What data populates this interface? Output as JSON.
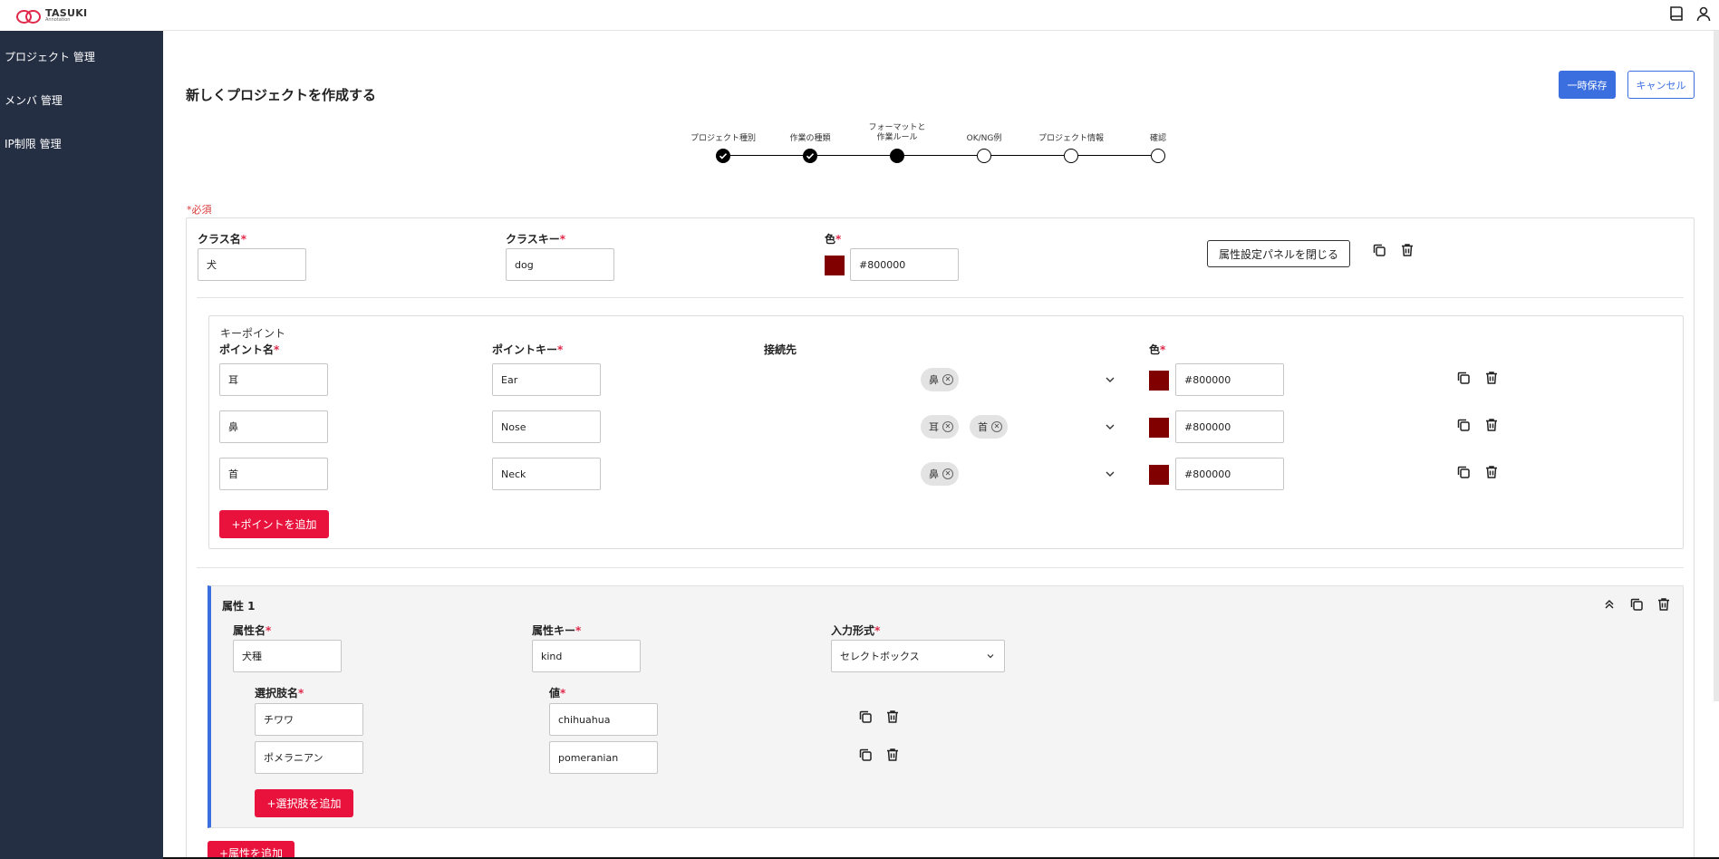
{
  "app": {
    "logo_line1": "TASUKI",
    "logo_line2": "Annotation"
  },
  "sidebar": {
    "items": [
      {
        "label": "プロジェクト 管理"
      },
      {
        "label": "メンバ 管理"
      },
      {
        "label": "IP制限 管理"
      }
    ]
  },
  "topbar": {
    "icons": [
      "book-icon",
      "user-icon"
    ]
  },
  "header": {
    "title": "新しくプロジェクトを作成する",
    "save_label": "一時保存",
    "cancel_label": "キャンセル"
  },
  "stepper": {
    "steps": [
      {
        "label": "プロジェクト種別",
        "state": "done"
      },
      {
        "label": "作業の種類",
        "state": "done"
      },
      {
        "label": "フォーマットと\n作業ルール",
        "state": "current"
      },
      {
        "label": "OK/NG例",
        "state": "pending"
      },
      {
        "label": "プロジェクト情報",
        "state": "pending"
      },
      {
        "label": "確認",
        "state": "pending"
      }
    ]
  },
  "form": {
    "required_note": "必須",
    "class": {
      "name_label": "クラス名",
      "name_value": "犬",
      "key_label": "クラスキー",
      "key_value": "dog",
      "color_label": "色",
      "color_value": "#800000",
      "close_panel_label": "属性設定パネルを閉じる"
    },
    "keypoints": {
      "caption": "キーポイント",
      "col_name": "ポイント名",
      "col_key": "ポイントキー",
      "col_connect": "接続先",
      "col_color": "色",
      "rows": [
        {
          "name": "耳",
          "key": "Ear",
          "connections": [
            "鼻"
          ],
          "color": "#800000"
        },
        {
          "name": "鼻",
          "key": "Nose",
          "connections": [
            "耳",
            "首"
          ],
          "color": "#800000"
        },
        {
          "name": "首",
          "key": "Neck",
          "connections": [
            "鼻"
          ],
          "color": "#800000"
        }
      ],
      "add_label": "+ポイントを追加"
    },
    "attribute": {
      "title": "属性 1",
      "name_label": "属性名",
      "name_value": "犬種",
      "key_label": "属性キー",
      "key_value": "kind",
      "input_type_label": "入力形式",
      "input_type_value": "セレクトボックス",
      "option_name_label": "選択肢名",
      "option_value_label": "値",
      "options": [
        {
          "name": "チワワ",
          "value": "chihuahua"
        },
        {
          "name": "ポメラニアン",
          "value": "pomeranian"
        }
      ],
      "add_option_label": "+選択肢を追加"
    },
    "add_attribute_label": "+属性を追加"
  },
  "colors": {
    "sidebar_bg": "#252f44",
    "primary": "#3b6fe0",
    "danger": "#e8123c",
    "swatch": "#800000"
  }
}
